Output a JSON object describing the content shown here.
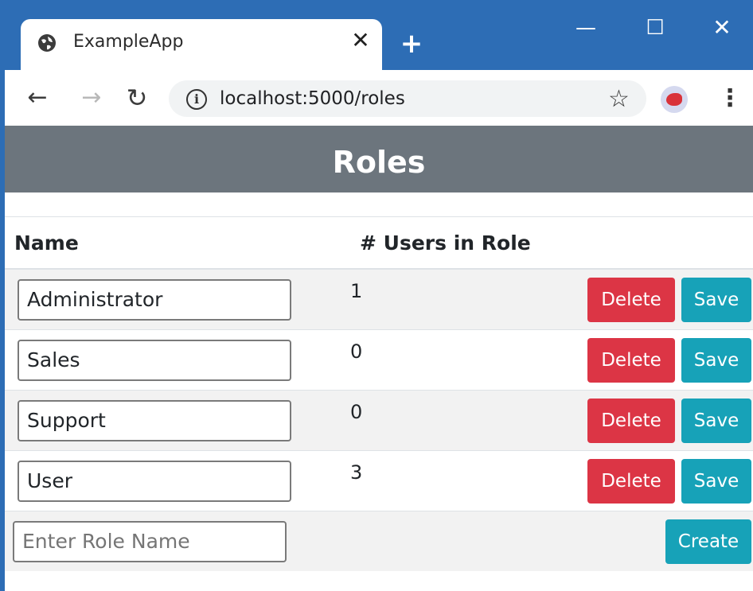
{
  "browser": {
    "tab_title": "ExampleApp",
    "tab_close": "✕",
    "new_tab": "+",
    "minimize": "—",
    "maximize": "☐",
    "close": "✕",
    "url": "localhost:5000/roles"
  },
  "page": {
    "title": "Roles",
    "columns": [
      "Name",
      "# Users in Role"
    ],
    "roles": [
      {
        "name": "Administrator",
        "users": "1",
        "delete_label": "Delete",
        "save_label": "Save"
      },
      {
        "name": "Sales",
        "users": "0",
        "delete_label": "Delete",
        "save_label": "Save"
      },
      {
        "name": "Support",
        "users": "0",
        "delete_label": "Delete",
        "save_label": "Save"
      },
      {
        "name": "User",
        "users": "3",
        "delete_label": "Delete",
        "save_label": "Save"
      }
    ],
    "create": {
      "placeholder": "Enter Role Name",
      "button_label": "Create"
    }
  },
  "colors": {
    "header_bg": "#6c757d",
    "danger": "#dc3545",
    "info": "#17a2b8",
    "chrome_frame": "#2d6db5"
  }
}
